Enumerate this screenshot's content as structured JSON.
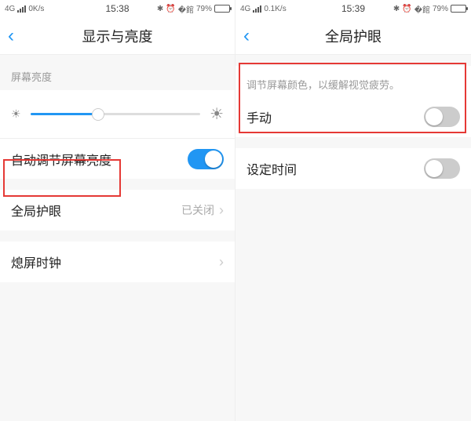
{
  "left": {
    "statusbar": {
      "net": "4G",
      "speed": "0K/s",
      "time": "15:38",
      "battery": "79%"
    },
    "title": "显示与亮度",
    "brightness_label": "屏幕亮度",
    "auto_brightness": "自动调节屏幕亮度",
    "eye_care": {
      "label": "全局护眼",
      "value": "已关闭"
    },
    "screen_clock": "熄屏时钟"
  },
  "right": {
    "statusbar": {
      "net": "4G",
      "speed": "0.1K/s",
      "time": "15:39",
      "battery": "79%"
    },
    "title": "全局护眼",
    "hint": "调节屏幕颜色，以缓解视觉疲劳。",
    "manual": "手动",
    "set_time": "设定时间"
  }
}
